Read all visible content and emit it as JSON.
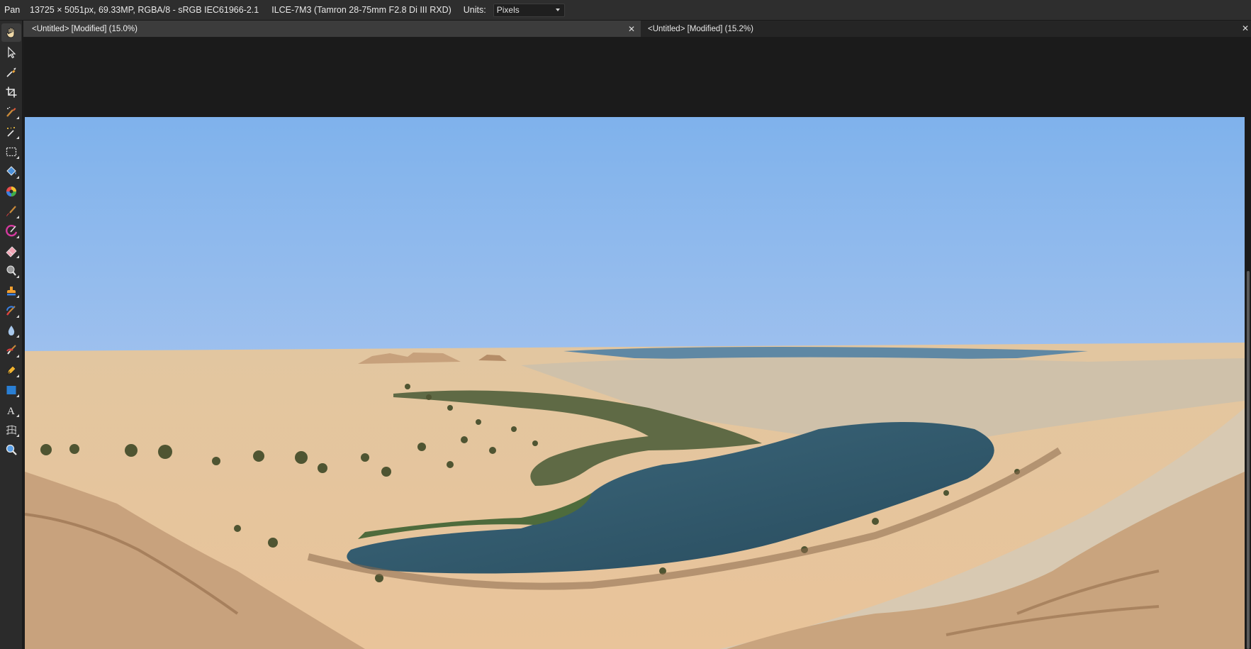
{
  "context_toolbar": {
    "tool_name": "Pan",
    "document_info": "13725 × 5051px, 69.33MP, RGBA/8 - sRGB IEC61966-2.1",
    "camera_info": "ILCE-7M3 (Tamron 28-75mm F2.8 Di III RXD)",
    "units_label": "Units:",
    "units_value": "Pixels"
  },
  "tabs": [
    {
      "label": "<Untitled> [Modified] (15.0%)",
      "active": true,
      "close": "✕"
    },
    {
      "label": "<Untitled> [Modified] (15.2%)",
      "active": false
    }
  ],
  "window_close": "✕",
  "tools": [
    {
      "name": "view-tool",
      "icon": "hand-icon",
      "active": true
    },
    {
      "name": "move-tool",
      "icon": "pointer-arrow-icon"
    },
    {
      "name": "color-picker-tool",
      "icon": "eyedropper-icon"
    },
    {
      "name": "crop-tool",
      "icon": "crop-icon"
    },
    {
      "name": "selection-brush-tool",
      "icon": "selection-brush-icon",
      "flyout": true
    },
    {
      "name": "flood-select-tool",
      "icon": "magic-wand-icon",
      "flyout": true
    },
    {
      "name": "marquee-tool",
      "icon": "rectangle-marquee-icon",
      "flyout": true
    },
    {
      "name": "flood-fill-tool",
      "icon": "paint-bucket-icon",
      "flyout": true
    },
    {
      "name": "color-replacement-tool",
      "icon": "color-wheel-icon"
    },
    {
      "name": "paint-brush-tool",
      "icon": "paint-brush-icon",
      "flyout": true
    },
    {
      "name": "color-brush-tool",
      "icon": "color-brush-icon",
      "flyout": true
    },
    {
      "name": "erase-brush-tool",
      "icon": "eraser-icon",
      "flyout": true
    },
    {
      "name": "dodge-tool",
      "icon": "dodge-icon",
      "flyout": true
    },
    {
      "name": "clone-tool",
      "icon": "stamp-icon",
      "flyout": true
    },
    {
      "name": "inpainting-tool",
      "icon": "healing-brush-icon",
      "flyout": true
    },
    {
      "name": "blur-tool",
      "icon": "blur-drop-icon",
      "flyout": true
    },
    {
      "name": "smudge-tool",
      "icon": "smudge-brush-icon",
      "flyout": true
    },
    {
      "name": "pen-tool",
      "icon": "pen-nib-icon",
      "flyout": true
    },
    {
      "name": "shape-tool",
      "icon": "rectangle-shape-icon",
      "flyout": true
    },
    {
      "name": "text-tool",
      "icon": "text-icon",
      "flyout": true
    },
    {
      "name": "mesh-warp-tool",
      "icon": "mesh-warp-icon",
      "flyout": true
    },
    {
      "name": "zoom-tool",
      "icon": "magnifier-icon"
    }
  ],
  "colors": {
    "accent_blue": "#2a7fd4",
    "toolbar_bg": "#2e2e2e",
    "canvas_bg": "#1b1b1b"
  }
}
